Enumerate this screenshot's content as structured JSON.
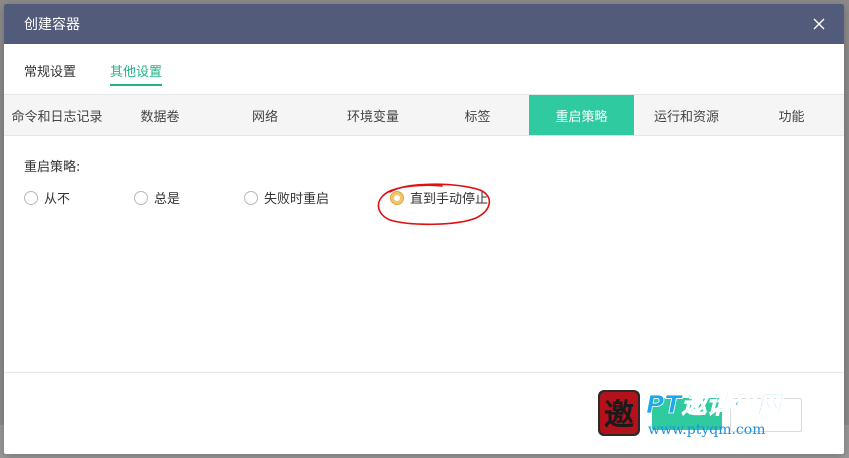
{
  "dialog": {
    "title": "创建容器"
  },
  "main_tabs": [
    {
      "label": "常规设置",
      "active": false
    },
    {
      "label": "其他设置",
      "active": true
    }
  ],
  "sub_tabs": [
    {
      "label": "命令和日志记录",
      "active": false
    },
    {
      "label": "数据卷",
      "active": false
    },
    {
      "label": "网络",
      "active": false
    },
    {
      "label": "环境变量",
      "active": false
    },
    {
      "label": "标签",
      "active": false
    },
    {
      "label": "重启策略",
      "active": true
    },
    {
      "label": "运行和资源",
      "active": false
    },
    {
      "label": "功能",
      "active": false
    }
  ],
  "restart_policy": {
    "label": "重启策略:",
    "options": [
      {
        "label": "从不",
        "checked": false
      },
      {
        "label": "总是",
        "checked": false
      },
      {
        "label": "失败时重启",
        "checked": false
      },
      {
        "label": "直到手动停止",
        "checked": true
      }
    ]
  },
  "watermark": {
    "seal_char": "邀",
    "brand": "PT邀请码网",
    "url": "www.ptyqm.com"
  },
  "colors": {
    "header_bg": "#525b79",
    "accent": "#2fcaa0",
    "radio_checked": "#f3c56e",
    "annotation": "#e01010"
  },
  "icons": {
    "close": "close-icon"
  }
}
